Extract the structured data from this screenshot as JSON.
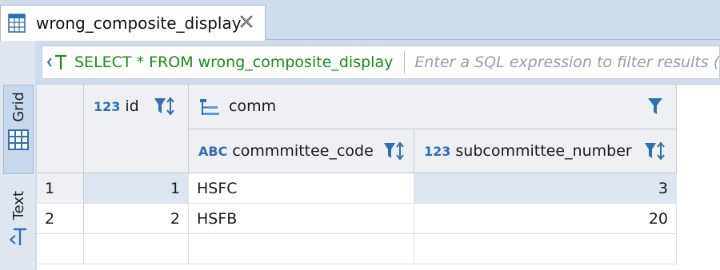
{
  "tab": {
    "title": "wrong_composite_display",
    "icon": "table-icon",
    "close_icon": "close-icon"
  },
  "side_tabs": {
    "grid_label": "Grid",
    "text_label": "Text"
  },
  "filter": {
    "query": "SELECT * FROM wrong_composite_display",
    "placeholder": "Enter a SQL expression to filter results (use Ctrl+Space)"
  },
  "columns": {
    "id": {
      "type": "123",
      "label": "id"
    },
    "group": {
      "label": "comm"
    },
    "code": {
      "type": "ABC",
      "label": "commmittee_code"
    },
    "sub": {
      "type": "123",
      "label": "subcommittee_number"
    }
  },
  "rows": [
    {
      "num": "1",
      "id": "1",
      "code": "HSFC",
      "sub": "3"
    },
    {
      "num": "2",
      "id": "2",
      "code": "HSFB",
      "sub": "20"
    }
  ],
  "colors": {
    "accent": "#2e6fb5",
    "query_green": "#1b8a1b",
    "selection": "#dce5f0"
  }
}
